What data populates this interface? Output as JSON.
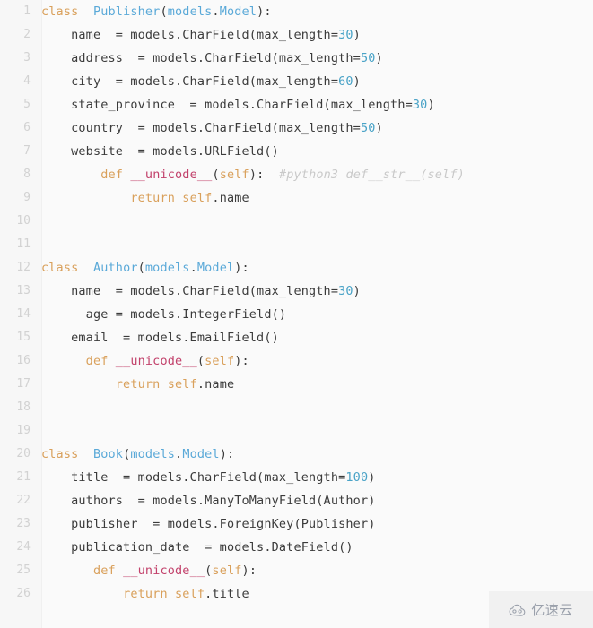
{
  "editor": {
    "language": "python",
    "background_color": "#fafafa",
    "gutter_color": "#f7f7f7",
    "line_number_color": "#d2d2d2",
    "default_text_color": "#3b3b3b",
    "total_lines": 26,
    "colors": {
      "keyword": "#d9a05b",
      "class_name": "#5aa9d8",
      "function_name": "#c2416b",
      "self": "#d9a05b",
      "number": "#4aa3c7",
      "comment": "#c9c9c9"
    }
  },
  "lines": [
    {
      "n": "1",
      "tokens": [
        {
          "t": "class ",
          "c": "k"
        },
        {
          "t": " ",
          "c": "pl"
        },
        {
          "t": "Publisher",
          "c": "cls"
        },
        {
          "t": "(",
          "c": "pl"
        },
        {
          "t": "models",
          "c": "cls"
        },
        {
          "t": ".",
          "c": "pl"
        },
        {
          "t": "Model",
          "c": "cls"
        },
        {
          "t": "):",
          "c": "pl"
        }
      ]
    },
    {
      "n": "2",
      "tokens": [
        {
          "t": "    name  = models.CharField(max_length=",
          "c": "pl"
        },
        {
          "t": "30",
          "c": "num"
        },
        {
          "t": ")",
          "c": "pl"
        }
      ]
    },
    {
      "n": "3",
      "tokens": [
        {
          "t": "    address  = models.CharField(max_length=",
          "c": "pl"
        },
        {
          "t": "50",
          "c": "num"
        },
        {
          "t": ")",
          "c": "pl"
        }
      ]
    },
    {
      "n": "4",
      "tokens": [
        {
          "t": "    city  = models.CharField(max_length=",
          "c": "pl"
        },
        {
          "t": "60",
          "c": "num"
        },
        {
          "t": ")",
          "c": "pl"
        }
      ]
    },
    {
      "n": "5",
      "tokens": [
        {
          "t": "    state_province  = models.CharField(max_length=",
          "c": "pl"
        },
        {
          "t": "30",
          "c": "num"
        },
        {
          "t": ")",
          "c": "pl"
        }
      ]
    },
    {
      "n": "6",
      "tokens": [
        {
          "t": "    country  = models.CharField(max_length=",
          "c": "pl"
        },
        {
          "t": "50",
          "c": "num"
        },
        {
          "t": ")",
          "c": "pl"
        }
      ]
    },
    {
      "n": "7",
      "tokens": [
        {
          "t": "    website  = models.URLField()",
          "c": "pl"
        }
      ]
    },
    {
      "n": "8",
      "tokens": [
        {
          "t": "        ",
          "c": "pl"
        },
        {
          "t": "def ",
          "c": "k"
        },
        {
          "t": "__unicode__",
          "c": "fn"
        },
        {
          "t": "(",
          "c": "pl"
        },
        {
          "t": "self",
          "c": "sf"
        },
        {
          "t": "):  ",
          "c": "pl"
        },
        {
          "t": "#python3 def__str__(self)",
          "c": "cm"
        }
      ]
    },
    {
      "n": "9",
      "tokens": [
        {
          "t": "            ",
          "c": "pl"
        },
        {
          "t": "return ",
          "c": "k"
        },
        {
          "t": "self",
          "c": "sf"
        },
        {
          "t": ".name",
          "c": "pl"
        }
      ]
    },
    {
      "n": "10",
      "tokens": [
        {
          "t": "",
          "c": "pl"
        }
      ]
    },
    {
      "n": "11",
      "tokens": [
        {
          "t": "",
          "c": "pl"
        }
      ]
    },
    {
      "n": "12",
      "tokens": [
        {
          "t": "class ",
          "c": "k"
        },
        {
          "t": " ",
          "c": "pl"
        },
        {
          "t": "Author",
          "c": "cls"
        },
        {
          "t": "(",
          "c": "pl"
        },
        {
          "t": "models",
          "c": "cls"
        },
        {
          "t": ".",
          "c": "pl"
        },
        {
          "t": "Model",
          "c": "cls"
        },
        {
          "t": "):",
          "c": "pl"
        }
      ]
    },
    {
      "n": "13",
      "tokens": [
        {
          "t": "    name  = models.CharField(max_length=",
          "c": "pl"
        },
        {
          "t": "30",
          "c": "num"
        },
        {
          "t": ")",
          "c": "pl"
        }
      ]
    },
    {
      "n": "14",
      "tokens": [
        {
          "t": "      age = models.IntegerField()",
          "c": "pl"
        }
      ]
    },
    {
      "n": "15",
      "tokens": [
        {
          "t": "    email  = models.EmailField()",
          "c": "pl"
        }
      ]
    },
    {
      "n": "16",
      "tokens": [
        {
          "t": "      ",
          "c": "pl"
        },
        {
          "t": "def ",
          "c": "k"
        },
        {
          "t": "__unicode__",
          "c": "fn"
        },
        {
          "t": "(",
          "c": "pl"
        },
        {
          "t": "self",
          "c": "sf"
        },
        {
          "t": "):",
          "c": "pl"
        }
      ]
    },
    {
      "n": "17",
      "tokens": [
        {
          "t": "          ",
          "c": "pl"
        },
        {
          "t": "return ",
          "c": "k"
        },
        {
          "t": "self",
          "c": "sf"
        },
        {
          "t": ".name",
          "c": "pl"
        }
      ]
    },
    {
      "n": "18",
      "tokens": [
        {
          "t": "",
          "c": "pl"
        }
      ]
    },
    {
      "n": "19",
      "tokens": [
        {
          "t": "",
          "c": "pl"
        }
      ]
    },
    {
      "n": "20",
      "tokens": [
        {
          "t": "class ",
          "c": "k"
        },
        {
          "t": " ",
          "c": "pl"
        },
        {
          "t": "Book",
          "c": "cls"
        },
        {
          "t": "(",
          "c": "pl"
        },
        {
          "t": "models",
          "c": "cls"
        },
        {
          "t": ".",
          "c": "pl"
        },
        {
          "t": "Model",
          "c": "cls"
        },
        {
          "t": "):",
          "c": "pl"
        }
      ]
    },
    {
      "n": "21",
      "tokens": [
        {
          "t": "    title  = models.CharField(max_length=",
          "c": "pl"
        },
        {
          "t": "100",
          "c": "num"
        },
        {
          "t": ")",
          "c": "pl"
        }
      ]
    },
    {
      "n": "22",
      "tokens": [
        {
          "t": "    authors  = models.ManyToManyField(Author)",
          "c": "pl"
        }
      ]
    },
    {
      "n": "23",
      "tokens": [
        {
          "t": "    publisher  = models.ForeignKey(Publisher)",
          "c": "pl"
        }
      ]
    },
    {
      "n": "24",
      "tokens": [
        {
          "t": "    publication_date  = models.DateField()",
          "c": "pl"
        }
      ]
    },
    {
      "n": "25",
      "tokens": [
        {
          "t": "       ",
          "c": "pl"
        },
        {
          "t": "def ",
          "c": "k"
        },
        {
          "t": "__unicode__",
          "c": "fn"
        },
        {
          "t": "(",
          "c": "pl"
        },
        {
          "t": "self",
          "c": "sf"
        },
        {
          "t": "):",
          "c": "pl"
        }
      ]
    },
    {
      "n": "26",
      "tokens": [
        {
          "t": "           ",
          "c": "pl"
        },
        {
          "t": "return ",
          "c": "k"
        },
        {
          "t": "self",
          "c": "sf"
        },
        {
          "t": ".title",
          "c": "pl"
        }
      ]
    }
  ],
  "watermark": {
    "text": "亿速云",
    "icon": "cloud-icon",
    "color": "#9aa0ab",
    "background": "#f1f1f1"
  }
}
